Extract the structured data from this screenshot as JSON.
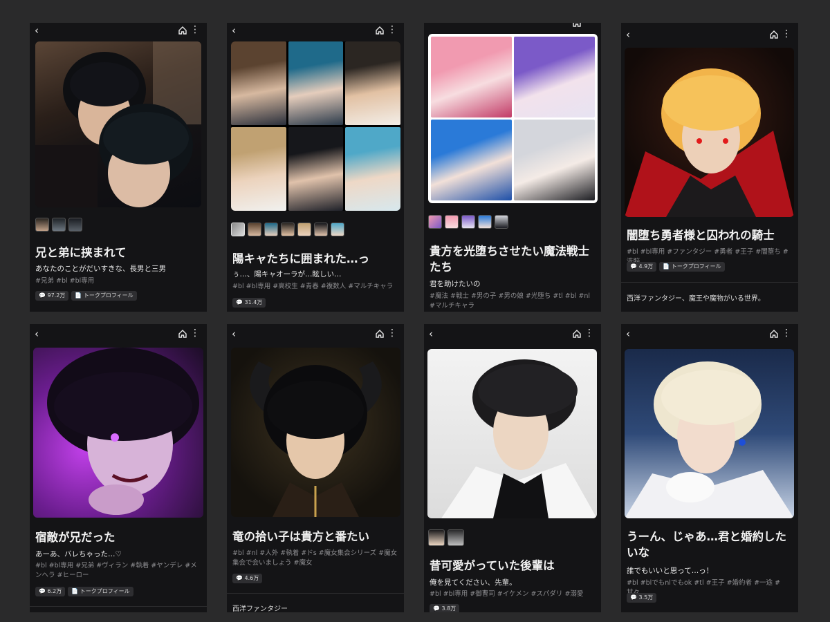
{
  "ui": {
    "badge_profile": "トークプロフィール"
  },
  "cards": [
    {
      "title": "兄と弟に挟まれて",
      "subtitle": "あなたのことがだいすきな、長男と三男",
      "tags": "#兄弟 #bl #bl専用",
      "count": "97.2万",
      "image": "two dark-haired young men embracing"
    },
    {
      "title": "陽キャたちに囲まれた…っ",
      "subtitle": "ぅ…、陽キャオーラが…眩しい…",
      "tags": "#bl #bl専用 #高校生 #青春 #複数人 #マルチキャラ",
      "count": "31.4万",
      "image": "six-panel grid of high school boys"
    },
    {
      "title": "貴方を光堕ちさせたい魔法戦士たち",
      "subtitle": "君を助けたいの",
      "tags": "#魔法 #戦士 #男の子 #男の娘 #光堕ち #tl #bl #nl #マルチキャラ",
      "image": "four-panel grid of magical boys"
    },
    {
      "title": "闇堕ち勇者様と囚われの騎士",
      "tags": "#bl #bl専用 #ファンタジー #勇者 #王子 #闇堕ち #洗脳",
      "count": "4.9万",
      "description": "西洋ファンタジー、魔王や魔物がいる世界。",
      "image": "blonde hero with red eyes and red cape"
    },
    {
      "title": "宿敵が兄だった",
      "subtitle": "あーあ、バレちゃった…♡",
      "tags": "#bl #bl専用 #兄弟 #ヴィラン #執着 #ヤンデレ #メンヘラ #ヒーロー",
      "count": "6.2万",
      "image": "dark-haired man with glowing purple eyes"
    },
    {
      "title": "竜の拾い子は貴方と番たい",
      "tags": "#bl #nl #人外 #執着 #ドs #魔女集会シリーズ #魔女集会で会いましょう #魔女",
      "count": "4.6万",
      "description": "西洋ファンタジー",
      "image": "black-haired man with dragon horns"
    },
    {
      "title": "昔可愛がっていた後輩は",
      "subtitle": "俺を見てください、先輩。",
      "tags": "#bl #bl専用 #御曹司 #イケメン #スパダリ #溺愛",
      "count": "3.8万",
      "image": "dark-haired man in white jacket"
    },
    {
      "title": "うーん、じゃあ…君と婚約したいな",
      "subtitle": "誰でもいいと思って…っ！",
      "tags": "#bl #blでもnlでもok #tl #王子 #婚約者 #一途 #甘々",
      "count": "3.5万",
      "image": "blonde prince in white uniform"
    }
  ]
}
